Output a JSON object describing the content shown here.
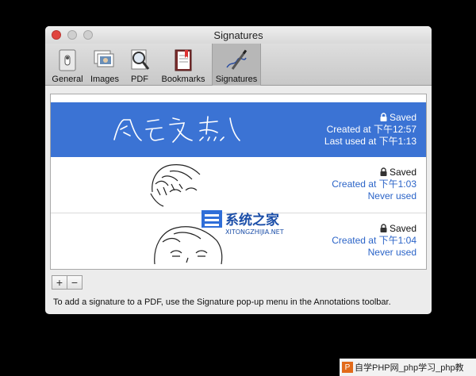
{
  "window": {
    "title": "Signatures"
  },
  "toolbar": {
    "items": [
      {
        "label": "General",
        "icon": "general-icon"
      },
      {
        "label": "Images",
        "icon": "images-icon"
      },
      {
        "label": "PDF",
        "icon": "pdf-icon"
      },
      {
        "label": "Bookmarks",
        "icon": "bookmarks-icon"
      },
      {
        "label": "Signatures",
        "icon": "signatures-icon",
        "selected": true
      }
    ]
  },
  "signatures": [
    {
      "status": "Saved",
      "created": "Created at 下午12:57",
      "last": "Last used at 下午1:13",
      "selected": true,
      "handwriting": "风云飞杰"
    },
    {
      "status": "Saved",
      "created": "Created at 下午1:03",
      "last": "Never used",
      "selected": false
    },
    {
      "status": "Saved",
      "created": "Created at 下午1:04",
      "last": "Never used",
      "selected": false
    }
  ],
  "buttons": {
    "add": "+",
    "remove": "−"
  },
  "hint": "To add a signature to a PDF, use the Signature pop-up menu in the Annotations toolbar.",
  "overlay": {
    "name": "系统之家",
    "url": "XITONGZHIJIA.NET"
  },
  "watermark": {
    "logo": "P",
    "text": "自学PHP网_php学习_php教"
  },
  "colors": {
    "selection": "#3b73d4",
    "link": "#2b64c8",
    "close": "#e0443e"
  }
}
